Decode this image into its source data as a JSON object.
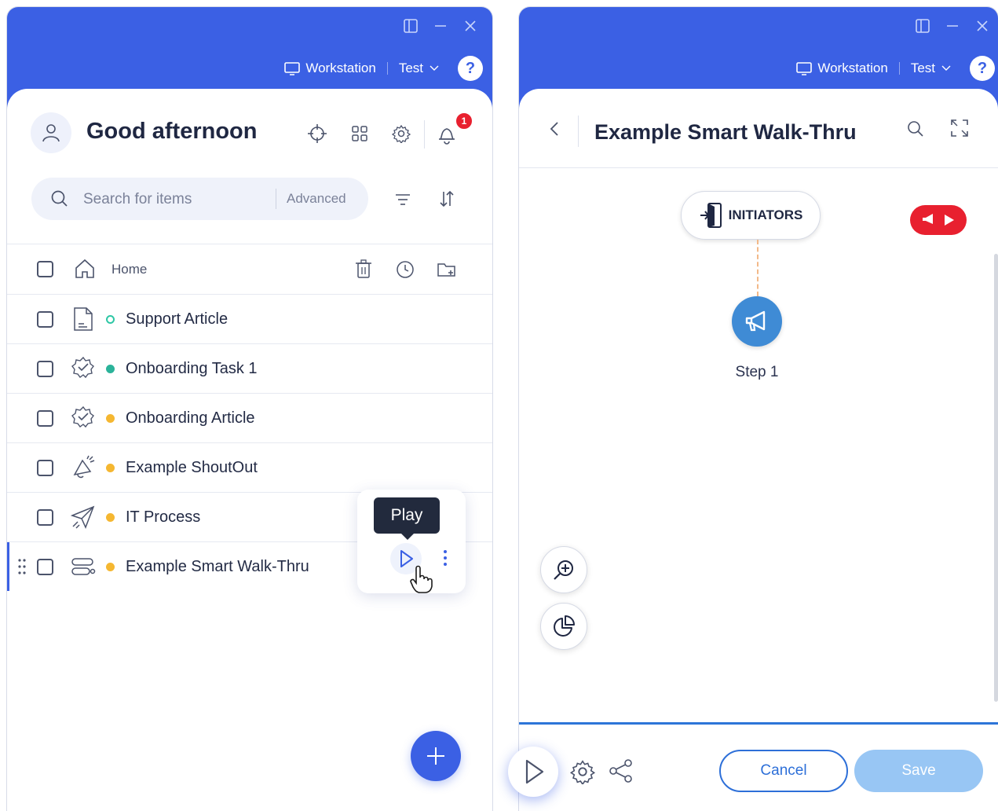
{
  "app": {
    "environment": "Workstation",
    "system": "Test",
    "help": "?"
  },
  "home_panel": {
    "greeting": "Good afternoon",
    "notification_count": "1",
    "search": {
      "placeholder": "Search for items",
      "advanced_label": "Advanced"
    },
    "folder_row": {
      "label": "Home"
    },
    "items": [
      {
        "label": "Support Article",
        "icon": "article-icon",
        "status_color": "#2ec7a5",
        "status": "draft-outline"
      },
      {
        "label": "Onboarding Task 1",
        "icon": "onboarding-task-icon",
        "status_color": "#2bb39a",
        "status": "published"
      },
      {
        "label": "Onboarding Article",
        "icon": "onboarding-article-icon",
        "status_color": "#f5b731",
        "status": "modified"
      },
      {
        "label": "Example ShoutOut",
        "icon": "shoutout-icon",
        "status_color": "#f5b731",
        "status": "modified"
      },
      {
        "label": "IT Process",
        "icon": "launcher-icon",
        "status_color": "#f5b731",
        "status": "modified"
      },
      {
        "label": "Example Smart Walk-Thru",
        "icon": "smart-walk-thru-icon",
        "status_color": "#f5b731",
        "status": "modified"
      }
    ],
    "tooltip": "Play"
  },
  "editor_panel": {
    "title": "Example Smart Walk-Thru",
    "initiators_label": "INITIATORS",
    "step_label": "Step 1",
    "cancel_label": "Cancel",
    "save_label": "Save"
  },
  "colors": {
    "brand_blue": "#3b60e4",
    "danger_red": "#e8202f",
    "step_blue": "#3f8bd5"
  }
}
